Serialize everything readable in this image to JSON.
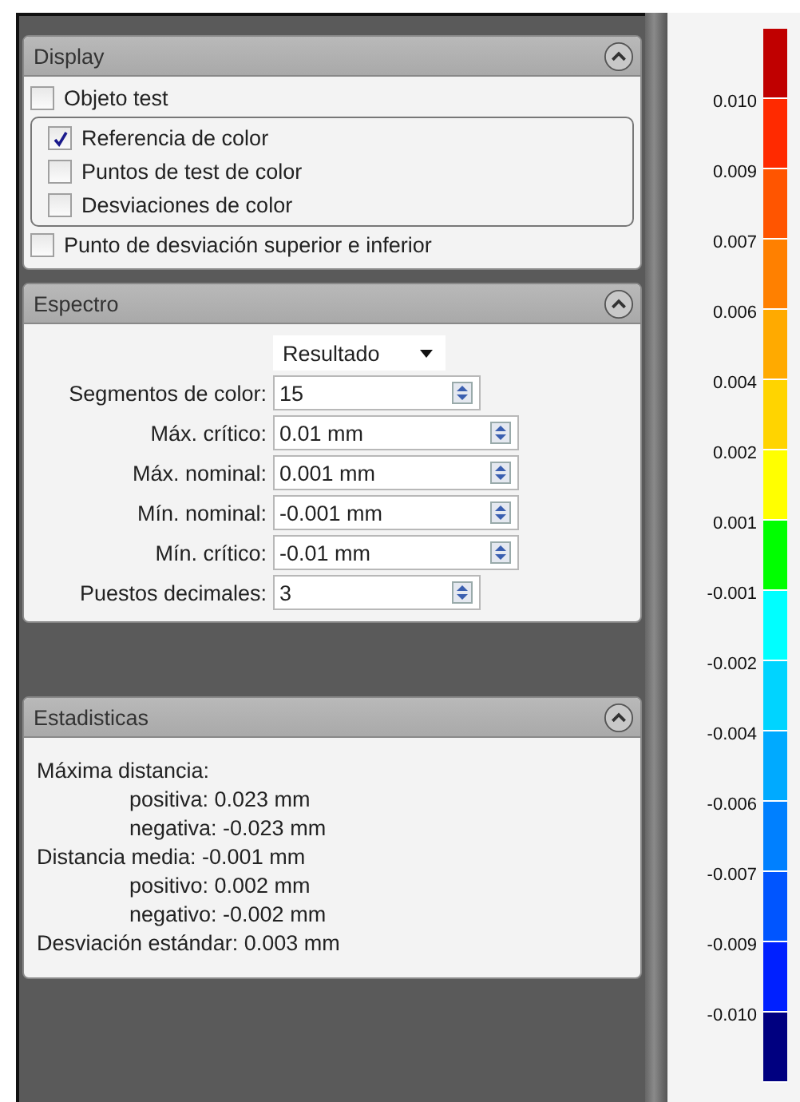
{
  "display": {
    "title": "Display",
    "items": [
      {
        "kind": "checkbox",
        "label": "Objeto test",
        "checked": false
      },
      {
        "kind": "group",
        "children": [
          {
            "kind": "checkbox",
            "label": "Referencia de color",
            "checked": true
          },
          {
            "kind": "checkbox",
            "label": "Puntos de test de color",
            "checked": false
          },
          {
            "kind": "checkbox",
            "label": "Desviaciones de color",
            "checked": false
          }
        ]
      },
      {
        "kind": "checkbox",
        "label": "Punto de desviación superior e inferior",
        "checked": false
      }
    ]
  },
  "spectrum": {
    "title": "Espectro",
    "dropdown": "Resultado",
    "fields": [
      {
        "kind": "integer",
        "label": "Segmentos de color:",
        "value": "15"
      },
      {
        "kind": "measure",
        "label": "Máx. crítico:",
        "value": "0.01 mm"
      },
      {
        "kind": "measure",
        "label": "Máx. nominal:",
        "value": "0.001 mm"
      },
      {
        "kind": "measure",
        "label": "Mín. nominal:",
        "value": "-0.001 mm"
      },
      {
        "kind": "measure",
        "label": "Mín. crítico:",
        "value": "-0.01 mm"
      },
      {
        "kind": "integer",
        "label": "Puestos decimales:",
        "value": "3"
      }
    ]
  },
  "statistics": {
    "title": "Estadisticas",
    "lines": [
      {
        "text": "Máxima distancia:",
        "children": [
          {
            "text": "positiva: 0.023 mm"
          },
          {
            "text": "negativa: -0.023 mm"
          }
        ]
      },
      {
        "text": "Distancia media: -0.001 mm",
        "children": [
          {
            "text": "positivo: 0.002 mm"
          },
          {
            "text": "negativo: -0.002 mm"
          }
        ]
      },
      {
        "text": "Desviación estándar: 0.003 mm"
      }
    ]
  },
  "legend": [
    {
      "color": "#c00000",
      "label": "0.010"
    },
    {
      "color": "#ff2a00",
      "label": "0.009"
    },
    {
      "color": "#ff5500",
      "label": "0.007"
    },
    {
      "color": "#ff8000",
      "label": "0.006"
    },
    {
      "color": "#ffaa00",
      "label": "0.004"
    },
    {
      "color": "#ffd400",
      "label": "0.002"
    },
    {
      "color": "#ffff00",
      "label": "0.001"
    },
    {
      "color": "#00ff00",
      "label": "-0.001"
    },
    {
      "color": "#00ffff",
      "label": "-0.002"
    },
    {
      "color": "#00d4ff",
      "label": "-0.004"
    },
    {
      "color": "#00aaff",
      "label": "-0.006"
    },
    {
      "color": "#0080ff",
      "label": "-0.007"
    },
    {
      "color": "#0055ff",
      "label": "-0.009"
    },
    {
      "color": "#0020ff",
      "label": "-0.010"
    },
    {
      "color": "#000080"
    }
  ]
}
